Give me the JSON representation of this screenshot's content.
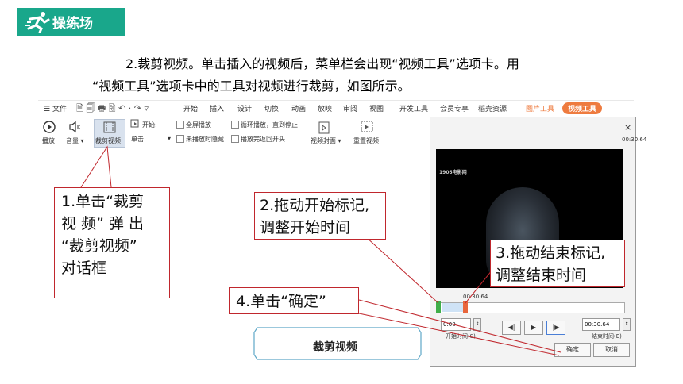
{
  "header": {
    "title": "操练场"
  },
  "instructions": {
    "line1": "2.裁剪视频。单击插入的视频后，菜单栏会出现“视频工具”选项卡。用",
    "line2": "“视频工具”选项卡中的工具对视频进行裁剪，如图所示。"
  },
  "ribbon": {
    "menu_label": "文件",
    "tabs": [
      "开始",
      "插入",
      "设计",
      "切换",
      "动画",
      "放映",
      "审阅",
      "视图",
      "开发工具",
      "会员专享",
      "稻壳资源",
      "图片工具",
      "视频工具"
    ],
    "play_label": "播放",
    "volume_label": "音量",
    "trim_label": "裁剪视频",
    "start_label": "开始:",
    "start_value": "单击",
    "fullscreen_label": "全屏播放",
    "hide_label": "未播放时隐藏",
    "loop_label": "循环播放，直到停止",
    "rewind_label": "播放完返回开头",
    "cover_label": "视频封面",
    "reset_label": "重置视频"
  },
  "dialog": {
    "close_icon": "×",
    "duration": "00:30.64",
    "video_logo": "1905电影网",
    "current_time": "00:30.64",
    "start_value": "0:00",
    "start_label": "开始时间(S)",
    "end_value": "00:30.64",
    "end_label": "结束时间(E)",
    "ok_label": "确定",
    "cancel_label": "取消"
  },
  "callouts": {
    "c1": [
      "1.单击“裁剪",
      "视 频” 弹 出",
      "“裁剪视频”",
      "对话框"
    ],
    "c2": [
      "2.拖动开始标记,",
      "调整开始时间"
    ],
    "c3": [
      "3.拖动结束标记,",
      "调整结束时间"
    ],
    "c4": "4.单击“确定”"
  },
  "caption": "裁剪视频",
  "colors": {
    "badge": "#19a78b",
    "accent": "#ee7b3f",
    "callout_border": "#c0272d"
  }
}
